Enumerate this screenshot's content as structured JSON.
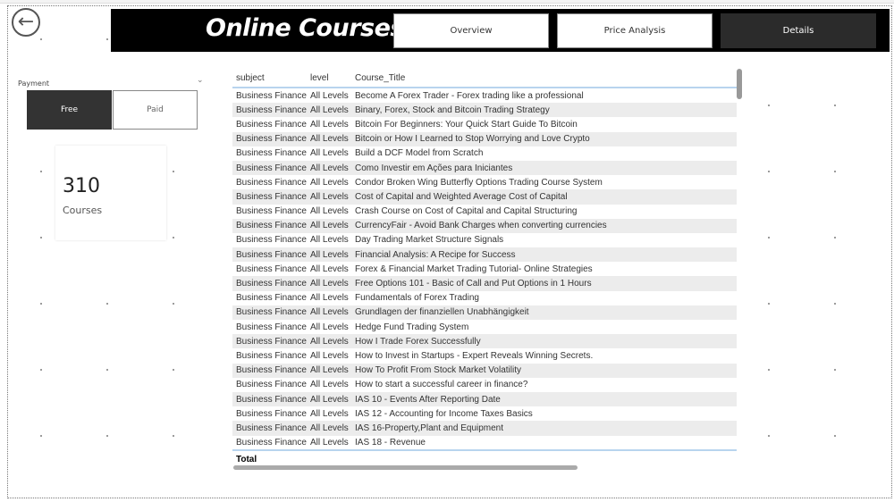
{
  "header": {
    "title": "Online Courses",
    "nav": [
      {
        "label": "Overview"
      },
      {
        "label": "Price Analysis"
      },
      {
        "label": "Details"
      }
    ]
  },
  "slicer": {
    "label": "Payment",
    "options": [
      {
        "label": "Free"
      },
      {
        "label": "Paid"
      }
    ],
    "selected": "Free"
  },
  "card": {
    "value": "310",
    "label": "Courses"
  },
  "table": {
    "columns": [
      "subject",
      "level",
      "Course_Title"
    ],
    "rows": [
      [
        "Business Finance",
        "All Levels",
        "Become A Forex Trader - Forex trading like a professional"
      ],
      [
        "Business Finance",
        "All Levels",
        "Binary, Forex, Stock and Bitcoin Trading Strategy"
      ],
      [
        "Business Finance",
        "All Levels",
        "Bitcoin For Beginners: Your Quick Start Guide To Bitcoin"
      ],
      [
        "Business Finance",
        "All Levels",
        "Bitcoin or How I Learned to Stop Worrying and Love Crypto"
      ],
      [
        "Business Finance",
        "All Levels",
        "Build a DCF Model from Scratch"
      ],
      [
        "Business Finance",
        "All Levels",
        "Como Investir em Ações para Iniciantes"
      ],
      [
        "Business Finance",
        "All Levels",
        "Condor Broken Wing Butterfly Options Trading Course System"
      ],
      [
        "Business Finance",
        "All Levels",
        "Cost of Capital and Weighted Average Cost of Capital"
      ],
      [
        "Business Finance",
        "All Levels",
        "Crash Course on Cost of Capital and Capital Structuring"
      ],
      [
        "Business Finance",
        "All Levels",
        "CurrencyFair - Avoid Bank Charges when converting currencies"
      ],
      [
        "Business Finance",
        "All Levels",
        "Day Trading Market Structure Signals"
      ],
      [
        "Business Finance",
        "All Levels",
        "Financial Analysis: A Recipe for Success"
      ],
      [
        "Business Finance",
        "All Levels",
        "Forex & Financial Market Trading Tutorial- Online Strategies"
      ],
      [
        "Business Finance",
        "All Levels",
        "Free Options 101 - Basic of Call and Put Options in 1 Hours"
      ],
      [
        "Business Finance",
        "All Levels",
        "Fundamentals of Forex Trading"
      ],
      [
        "Business Finance",
        "All Levels",
        "Grundlagen der finanziellen Unabhängigkeit"
      ],
      [
        "Business Finance",
        "All Levels",
        "Hedge Fund Trading System"
      ],
      [
        "Business Finance",
        "All Levels",
        "How I Trade Forex Successfully"
      ],
      [
        "Business Finance",
        "All Levels",
        "How to Invest in Startups - Expert Reveals Winning Secrets."
      ],
      [
        "Business Finance",
        "All Levels",
        "How To Profit From Stock Market Volatility"
      ],
      [
        "Business Finance",
        "All Levels",
        "How to start a successful career in finance?"
      ],
      [
        "Business Finance",
        "All Levels",
        "IAS 10 - Events After Reporting Date"
      ],
      [
        "Business Finance",
        "All Levels",
        "IAS 12 - Accounting for Income Taxes Basics"
      ],
      [
        "Business Finance",
        "All Levels",
        "IAS 16-Property,Plant and Equipment"
      ],
      [
        "Business Finance",
        "All Levels",
        "IAS 18 - Revenue"
      ]
    ],
    "total_label": "Total"
  },
  "colors": {
    "header_bg": "#000000",
    "active": "#2b2b2b",
    "accent_line": "#b8d4ee"
  }
}
